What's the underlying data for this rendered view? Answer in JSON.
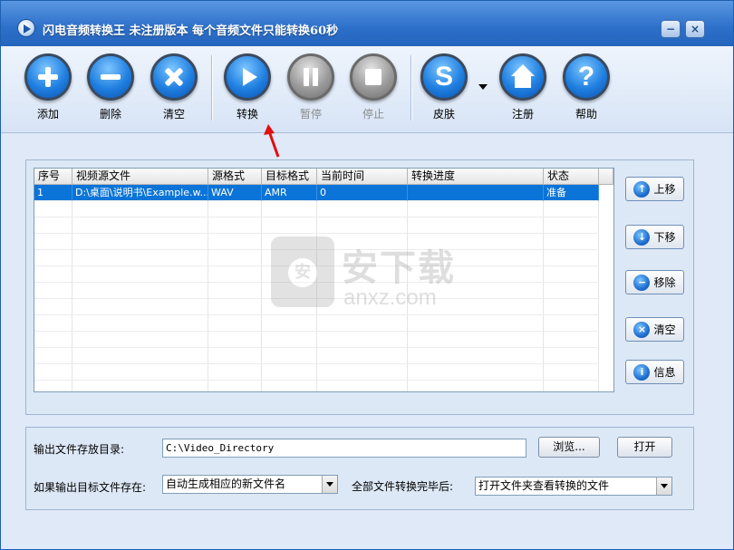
{
  "window": {
    "title": "闪电音频转换王  未注册版本 每个音频文件只能转换60秒",
    "minimize_glyph": "−",
    "close_glyph": "×"
  },
  "toolbar": {
    "add": {
      "label": "添加",
      "icon": "plus-icon"
    },
    "delete": {
      "label": "删除",
      "icon": "minus-icon"
    },
    "clear": {
      "label": "清空",
      "icon": "x-icon"
    },
    "convert": {
      "label": "转换",
      "icon": "play-icon"
    },
    "pause": {
      "label": "暂停",
      "icon": "pause-icon",
      "disabled": true
    },
    "stop": {
      "label": "停止",
      "icon": "stop-icon",
      "disabled": true
    },
    "skin": {
      "label": "皮肤",
      "icon": "s-icon",
      "letter": "S"
    },
    "register": {
      "label": "注册",
      "icon": "home-icon"
    },
    "help": {
      "label": "帮助",
      "icon": "question-icon",
      "letter": "?"
    }
  },
  "file_list": {
    "columns": [
      "序号",
      "视频源文件",
      "源格式",
      "目标格式",
      "当前时间",
      "转换进度",
      "状态"
    ],
    "rows": [
      {
        "index": "1",
        "source": "D:\\桌面\\说明书\\Example.w...",
        "src_format": "WAV",
        "dst_format": "AMR",
        "current_time": "0",
        "progress": "",
        "status": "准备"
      }
    ]
  },
  "side_buttons": {
    "move_up": {
      "label": "上移",
      "glyph": "↑"
    },
    "move_down": {
      "label": "下移",
      "glyph": "↓"
    },
    "remove": {
      "label": "移除",
      "glyph": "−"
    },
    "clear": {
      "label": "清空",
      "glyph": "×"
    },
    "info": {
      "label": "信息",
      "glyph": "i"
    }
  },
  "watermark": {
    "title": "安下载",
    "subtitle": "anxz.com",
    "badge": "安"
  },
  "output": {
    "dir_label": "输出文件存放目录:",
    "dir_value": "C:\\Video_Directory",
    "browse_label": "浏览...",
    "open_label": "打开",
    "exists_label": "如果输出目标文件存在:",
    "exists_value": "自动生成相应的新文件名",
    "after_label": "全部文件转换完毕后:",
    "after_value": "打开文件夹查看转换的文件"
  },
  "colors": {
    "selection": "#0a74d8",
    "button_blue": "#1f7fe0",
    "annotation_arrow": "#e01010"
  }
}
